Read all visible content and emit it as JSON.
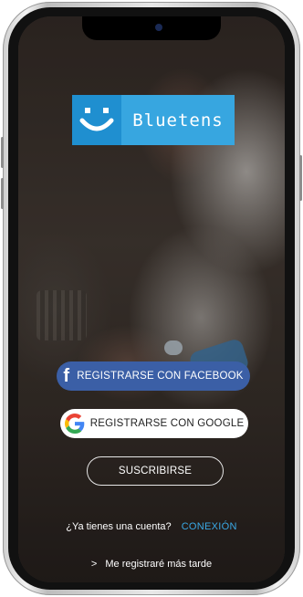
{
  "logo": {
    "brand_name": "Bluetens",
    "icon": "smiley-icon"
  },
  "buttons": {
    "facebook_label": "REGISTRARSE CON FACEBOOK",
    "google_label": "REGISTRARSE CON GOOGLE",
    "subscribe_label": "SUSCRIBIRSE"
  },
  "login": {
    "prompt": "¿Ya tienes una cuenta?",
    "link_label": "CONEXIÓN"
  },
  "skip": {
    "arrow": ">",
    "label": "Me registraré más tarde"
  },
  "colors": {
    "facebook": "#3b5fa6",
    "link": "#3aa9e6",
    "logo_dark": "#1f8fd0",
    "logo_light": "#37a6e0"
  }
}
